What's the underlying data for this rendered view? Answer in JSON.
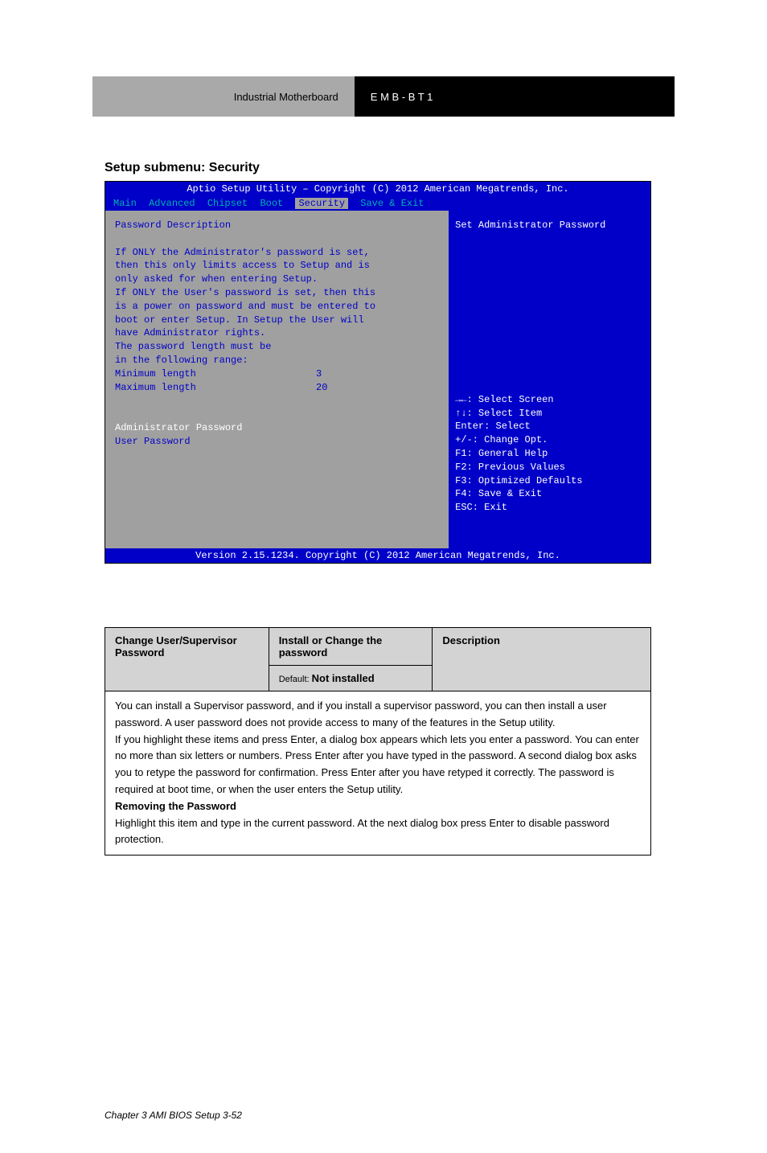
{
  "header": {
    "left": "Industrial Motherboard",
    "right": "E M B - B T 1"
  },
  "section_title": "Setup submenu: Security",
  "bios": {
    "title": "Aptio Setup Utility – Copyright (C) 2012 American Megatrends, Inc.",
    "tabs": [
      "Main",
      "Advanced",
      "Chipset",
      "Boot",
      "Security",
      "Save & Exit"
    ],
    "active_tab_index": 4,
    "left_panel": {
      "heading": "Password Description",
      "desc_lines": [
        "If ONLY the Administrator's password is set,",
        "then this only limits access to Setup and is",
        "only asked for when entering Setup.",
        "If ONLY the User's password is set, then this",
        "is a power on password and must be entered to",
        "boot or enter Setup. In Setup the User will",
        "have Administrator rights.",
        "The password length must be",
        "in the following range:"
      ],
      "min_label": "Minimum length",
      "min_val": "3",
      "max_label": "Maximum length",
      "max_val": "20",
      "admin_pw": "Administrator Password",
      "user_pw": "User Password"
    },
    "right_panel": {
      "help_top": "Set Administrator Password",
      "nav": [
        "→←: Select Screen",
        "↑↓: Select Item",
        "Enter: Select",
        "+/-: Change Opt.",
        "F1: General Help",
        "F2: Previous Values",
        "F3: Optimized Defaults",
        "F4: Save & Exit",
        "ESC: Exit"
      ]
    },
    "footer": "Version 2.15.1234. Copyright (C) 2012 American Megatrends, Inc."
  },
  "table": {
    "col_headers": [
      "Change User/Supervisor Password",
      "Install or Change the password",
      "Description"
    ],
    "default_label": "Default: ",
    "default_val": "Not installed",
    "desc_lines": [
      "You can install a Supervisor password, and if you install a supervisor password, you can then install a user password. A user password does not provide access to many of the features in the Setup utility.",
      "",
      "If you highlight these items and press Enter, a dialog box appears which lets you enter a password. You can enter no more than six letters or numbers. Press Enter after you have typed in the password. A second dialog box asks you to retype the password for confirmation. Press Enter after you have retyped it correctly. The password is required at boot time, or when the user enters the Setup utility.",
      "",
      "Removing the Password",
      "Highlight this item and type in the current password. At the next dialog box press Enter to disable password protection."
    ]
  },
  "page_num": "Chapter 3 AMI BIOS Setup                                                                     3-52"
}
